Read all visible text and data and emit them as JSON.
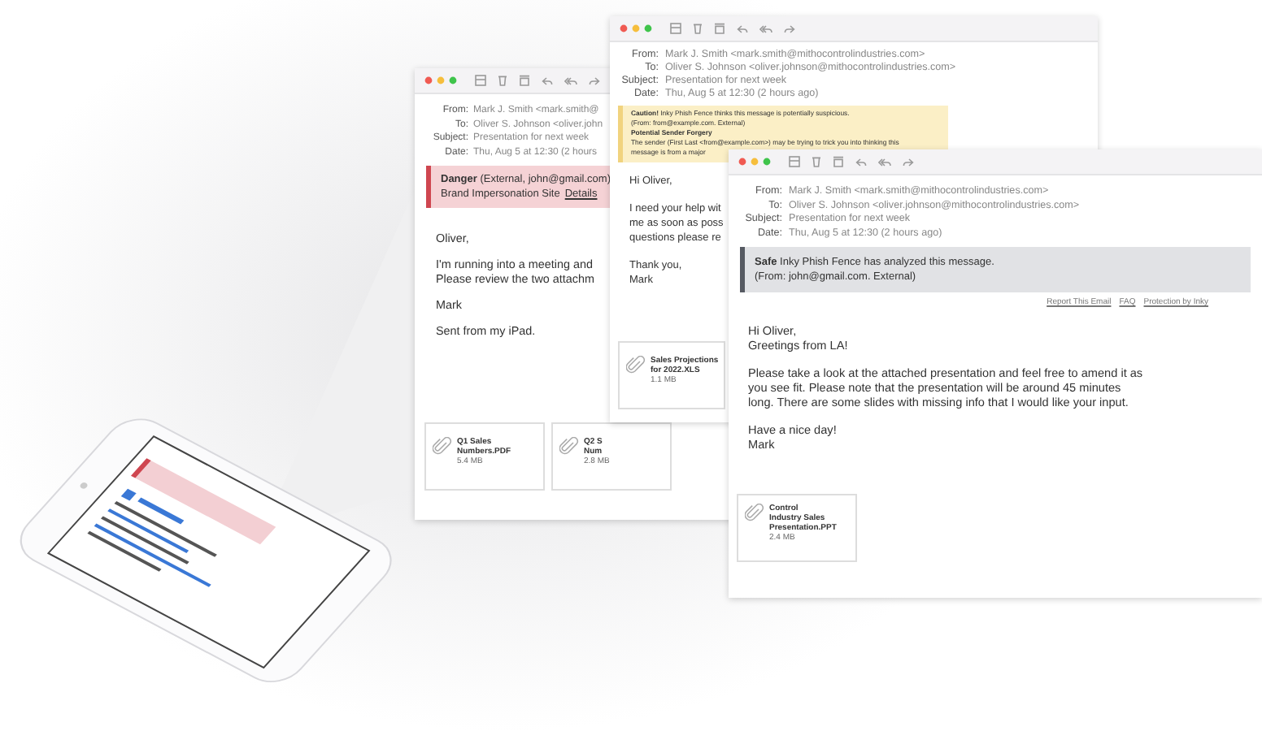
{
  "windows": [
    {
      "headers": [
        {
          "label": "From:",
          "value": "Mark J. Smith <mark.smith@"
        },
        {
          "label": "To:",
          "value": "Oliver S. Johnson <oliver.john"
        },
        {
          "label": "Subject:",
          "value": "Presentation for next week"
        },
        {
          "label": "Date:",
          "value": "Thu, Aug 5 at 12:30 (2 hours"
        }
      ],
      "banner": {
        "kind": "danger",
        "lines": [
          {
            "text": "**Danger** (External, john@gmail.com)",
            "strong": false
          },
          {
            "text": "Brand Impersonation Site",
            "strong": false
          }
        ],
        "link": "Details"
      },
      "body": [
        "Oliver,",
        "I'm running into a meeting and\nPlease review the two attachm",
        "Mark",
        "Sent from my iPad."
      ],
      "attachments": [
        {
          "name": "Q1 Sales\nNumbers.PDF",
          "size": "5.4 MB"
        },
        {
          "name": "Q2 S\nNum",
          "size": "2.8 MB"
        }
      ]
    },
    {
      "headers": [
        {
          "label": "From:",
          "value": "Mark J. Smith <mark.smith@mithocontrolindustries.com>"
        },
        {
          "label": "To:",
          "value": "Oliver S. Johnson <oliver.johnson@mithocontrolindustries.com>"
        },
        {
          "label": "Subject:",
          "value": "Presentation for next week"
        },
        {
          "label": "Date:",
          "value": "Thu, Aug 5 at 12:30 (2 hours ago)"
        }
      ],
      "banner": {
        "kind": "caution",
        "lines": [
          {
            "text": "**Caution!** Inky Phish Fence thinks this message is potentially suspicious.",
            "strong": false
          },
          {
            "text": "(From: from@example.com. External)",
            "strong": false
          },
          {
            "text": "Potential Sender Forgery",
            "strong": true
          },
          {
            "text": "The sender (First Last <from@example.com>) may be trying to trick you into thinking this",
            "strong": false
          },
          {
            "text": "message is from a major",
            "strong": false
          }
        ]
      },
      "body": [
        "Hi Oliver,",
        "I need your help wit\nme as soon as poss\nquestions please re",
        "Thank you,\nMark"
      ],
      "attachments": [
        {
          "name": "Sales Projections\nfor 2022.XLS",
          "size": "1.1 MB"
        }
      ]
    },
    {
      "headers": [
        {
          "label": "From:",
          "value": "Mark J. Smith <mark.smith@mithocontrolindustries.com>"
        },
        {
          "label": "To:",
          "value": "Oliver S. Johnson <oliver.johnson@mithocontrolindustries.com>"
        },
        {
          "label": "Subject:",
          "value": "Presentation for next week"
        },
        {
          "label": "Date:",
          "value": "Thu, Aug 5 at 12:30 (2 hours ago)"
        }
      ],
      "banner": {
        "kind": "safe",
        "lines": [
          {
            "text": "**Safe** Inky Phish Fence has analyzed this message.",
            "strong": false
          },
          {
            "text": "(From: john@gmail.com. External)",
            "strong": false
          }
        ]
      },
      "links": [
        "Report This Email",
        "FAQ",
        "Protection by Inky"
      ],
      "body": [
        "Hi Oliver,\nGreetings from LA!",
        "Please take a look at the attached presentation and feel free to amend it as\nyou see fit. Please note that the presentation will be around 45 minutes\nlong. There are some slides with missing info that I would like your input.",
        "Have a nice day!\nMark"
      ],
      "attachments": [
        {
          "name": "Control\nIndustry Sales\nPresentation.PPT",
          "size": "2.4 MB"
        }
      ]
    }
  ]
}
